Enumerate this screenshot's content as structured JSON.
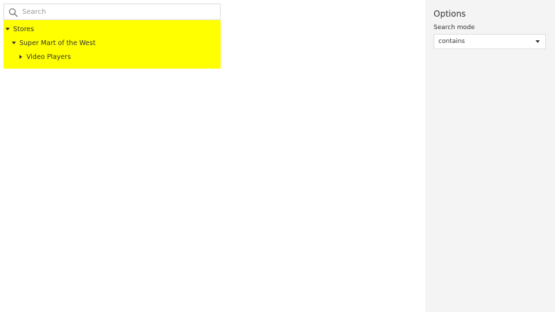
{
  "search": {
    "placeholder": "Search",
    "value": ""
  },
  "tree": {
    "background": "#ffff00",
    "nodes": [
      {
        "label": "Stores",
        "expanded": true
      },
      {
        "label": "Super Mart of the West",
        "expanded": true
      },
      {
        "label": "Video Players",
        "expanded": false
      }
    ]
  },
  "options": {
    "title": "Options",
    "search_mode": {
      "label": "Search mode",
      "selected": "contains"
    }
  },
  "icons": {
    "search": "search-icon",
    "expanded": "caret-down-icon",
    "collapsed": "caret-right-icon",
    "dropdown": "chevron-down-icon"
  }
}
